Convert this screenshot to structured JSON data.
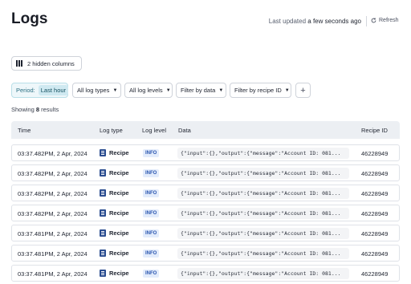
{
  "page": {
    "title": "Logs",
    "updated_prefix": "Last updated",
    "updated_value": "a few seconds ago",
    "refresh_label": "Refresh"
  },
  "toolbar": {
    "hidden_columns_label": "2 hidden columns"
  },
  "filters": {
    "period_label": "Period:",
    "period_value": "Last hour",
    "log_types": "All log types",
    "log_levels": "All log levels",
    "by_data": "Filter by data",
    "by_recipe": "Filter by recipe ID",
    "add": "+"
  },
  "results": {
    "prefix": "Showing",
    "count": "8",
    "suffix": "results"
  },
  "table": {
    "headers": {
      "time": "Time",
      "log_type": "Log type",
      "log_level": "Log level",
      "data": "Data",
      "recipe_id": "Recipe ID"
    },
    "rows": [
      {
        "time": "03:37.482PM, 2 Apr, 2024",
        "type": "Recipe",
        "level": "INFO",
        "data": "{\"input\":{},\"output\":{\"message\":\"Account ID: 081...",
        "recipe_id": "46228949"
      },
      {
        "time": "03:37.482PM, 2 Apr, 2024",
        "type": "Recipe",
        "level": "INFO",
        "data": "{\"input\":{},\"output\":{\"message\":\"Account ID: 081...",
        "recipe_id": "46228949"
      },
      {
        "time": "03:37.482PM, 2 Apr, 2024",
        "type": "Recipe",
        "level": "INFO",
        "data": "{\"input\":{},\"output\":{\"message\":\"Account ID: 081...",
        "recipe_id": "46228949"
      },
      {
        "time": "03:37.482PM, 2 Apr, 2024",
        "type": "Recipe",
        "level": "INFO",
        "data": "{\"input\":{},\"output\":{\"message\":\"Account ID: 081...",
        "recipe_id": "46228949"
      },
      {
        "time": "03:37.481PM, 2 Apr, 2024",
        "type": "Recipe",
        "level": "INFO",
        "data": "{\"input\":{},\"output\":{\"message\":\"Account ID: 081...",
        "recipe_id": "46228949"
      },
      {
        "time": "03:37.481PM, 2 Apr, 2024",
        "type": "Recipe",
        "level": "INFO",
        "data": "{\"input\":{},\"output\":{\"message\":\"Account ID: 081...",
        "recipe_id": "46228949"
      },
      {
        "time": "03:37.481PM, 2 Apr, 2024",
        "type": "Recipe",
        "level": "INFO",
        "data": "{\"input\":{},\"output\":{\"message\":\"Account ID: 081...",
        "recipe_id": "46228949"
      }
    ]
  },
  "icons": {
    "refresh": "refresh-icon",
    "columns": "columns-icon",
    "recipe": "recipe-icon",
    "caret": "chevron-down-icon"
  },
  "colors": {
    "period_bg": "#eef7fa",
    "period_value_bg": "#cfe9f1",
    "info_badge_bg": "#e3ecfb",
    "info_badge_text": "#2b56b0",
    "header_bg": "#eceff3"
  }
}
